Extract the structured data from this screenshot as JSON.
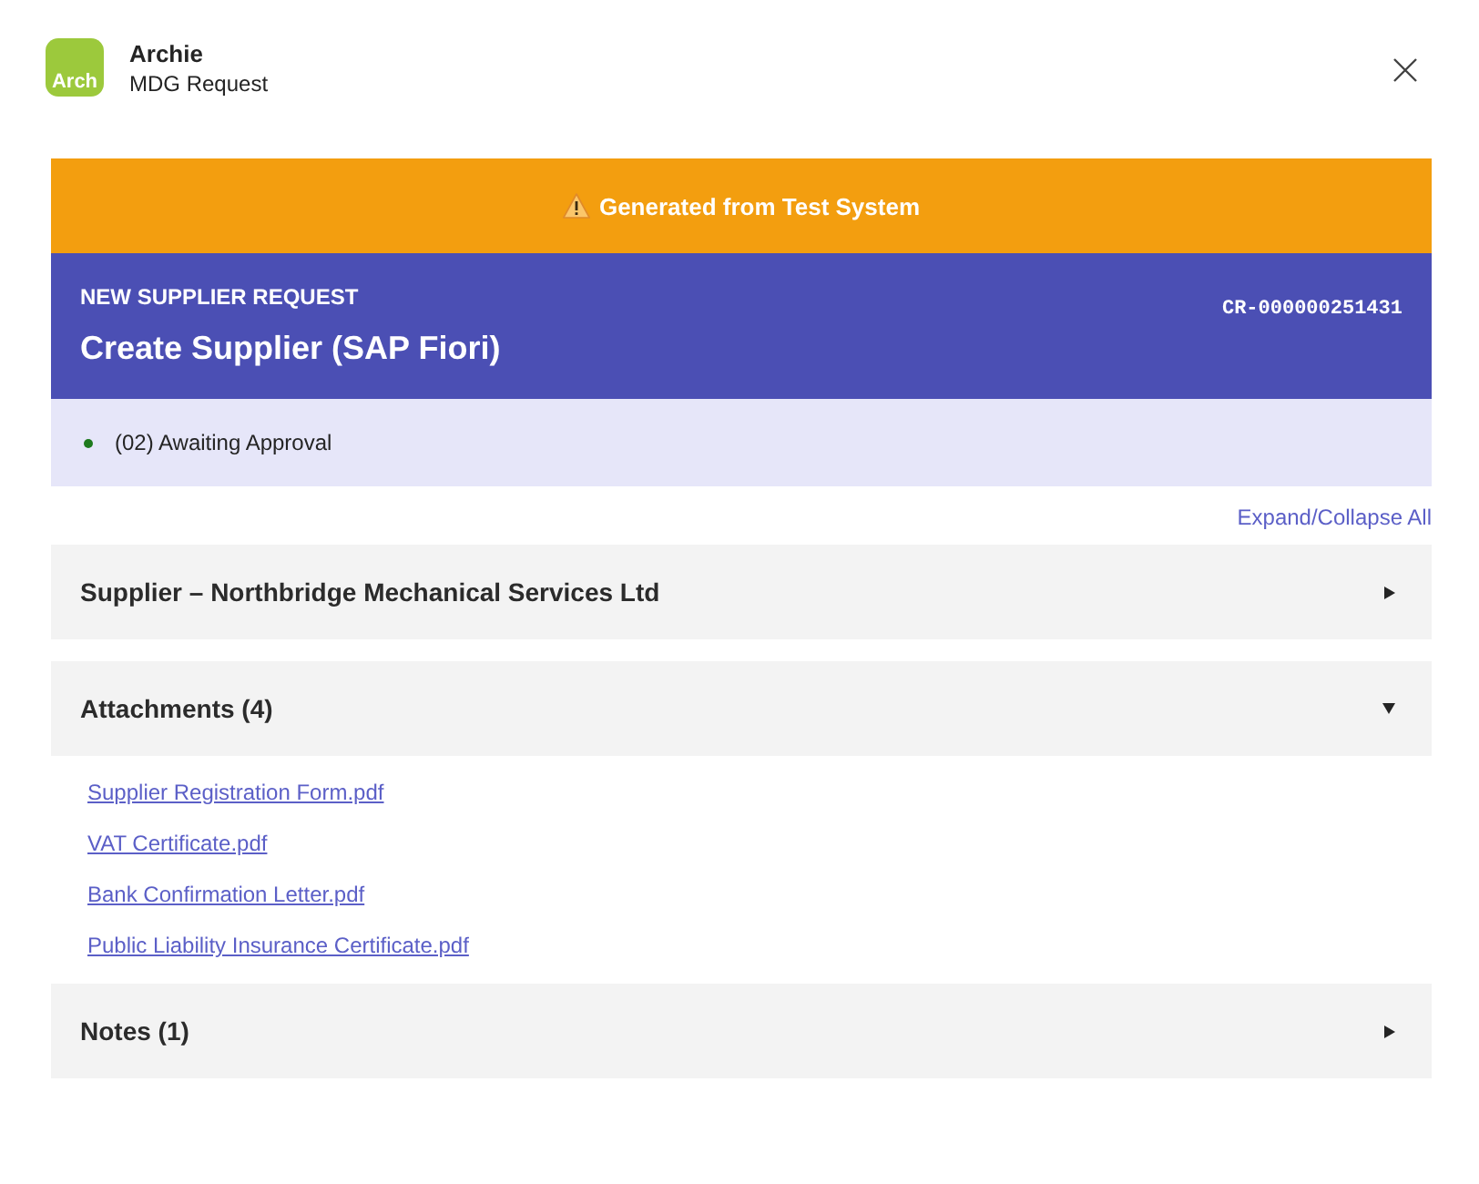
{
  "app": {
    "logo_text": "Arch",
    "name": "Archie",
    "subtitle": "MDG Request"
  },
  "banner": {
    "text": "Generated from Test System"
  },
  "request": {
    "category": "NEW SUPPLIER REQUEST",
    "title": "Create Supplier (SAP Fiori)",
    "id": "CR-000000251431"
  },
  "status": {
    "text": "(02) Awaiting Approval",
    "color": "#1e7a1e"
  },
  "expand_collapse_all": "Expand/Collapse All",
  "sections": [
    {
      "title": "Supplier – Northbridge Mechanical Services Ltd",
      "expanded": false
    },
    {
      "title": "Attachments (4)",
      "expanded": true,
      "attachments": [
        "Supplier Registration Form.pdf",
        "VAT Certificate.pdf",
        "Bank Confirmation Letter.pdf",
        "Public Liability Insurance Certificate.pdf"
      ]
    },
    {
      "title": "Notes (1)",
      "expanded": false
    }
  ]
}
